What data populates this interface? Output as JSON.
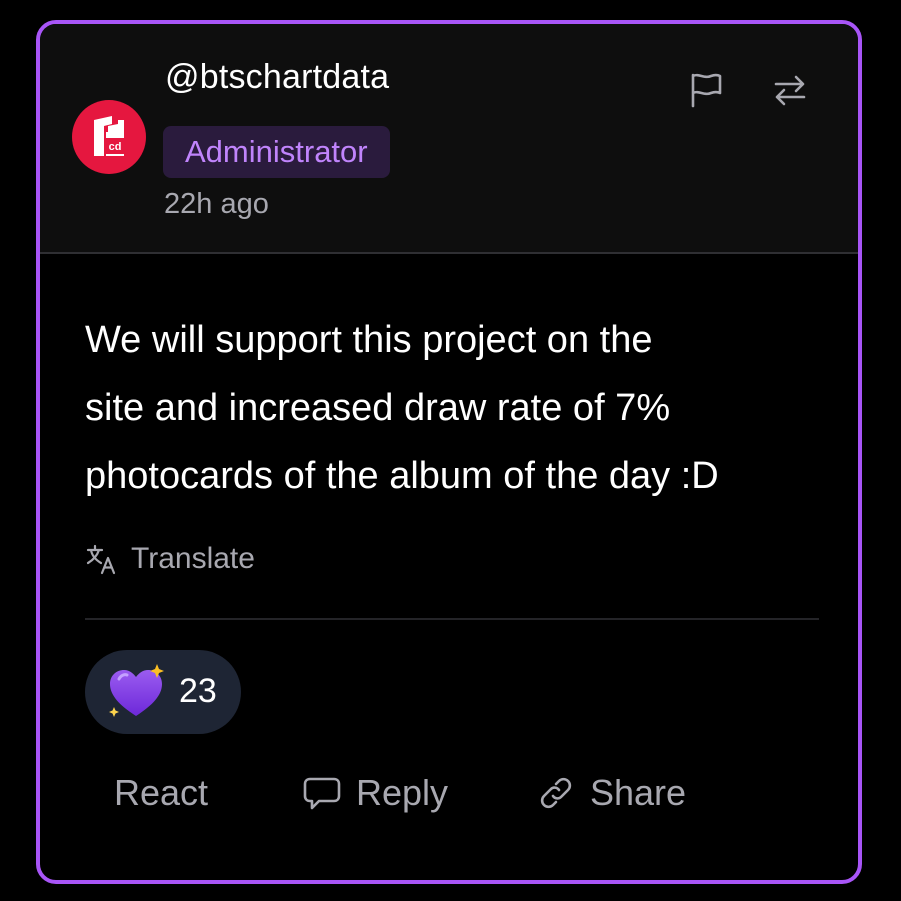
{
  "post": {
    "username": "@btschartdata",
    "role": "Administrator",
    "timestamp": "22h ago",
    "avatar_initials": "cd",
    "body": "We will support this project on the site and increased draw rate of 7% photocards of the album of the day :D",
    "body_lines": [
      "We will support this project on the",
      "site and increased draw rate of 7%",
      "photocards of the album of the day :D"
    ],
    "translate_label": "Translate"
  },
  "header_icons": [
    {
      "name": "flag-icon"
    },
    {
      "name": "repost-icon"
    }
  ],
  "reaction": {
    "emoji_icon": "purple-heart-sparkle-icon",
    "count": "23"
  },
  "actions": {
    "react_label": "React",
    "reply_label": "Reply",
    "share_label": "Share"
  },
  "colors": {
    "accent_border": "#a855f7",
    "role_text": "#c084fc",
    "role_bg": "#2a1b3d",
    "avatar_bg": "#e5173f",
    "reaction_bg": "#1e2534",
    "muted_text": "#a8a8b0"
  }
}
